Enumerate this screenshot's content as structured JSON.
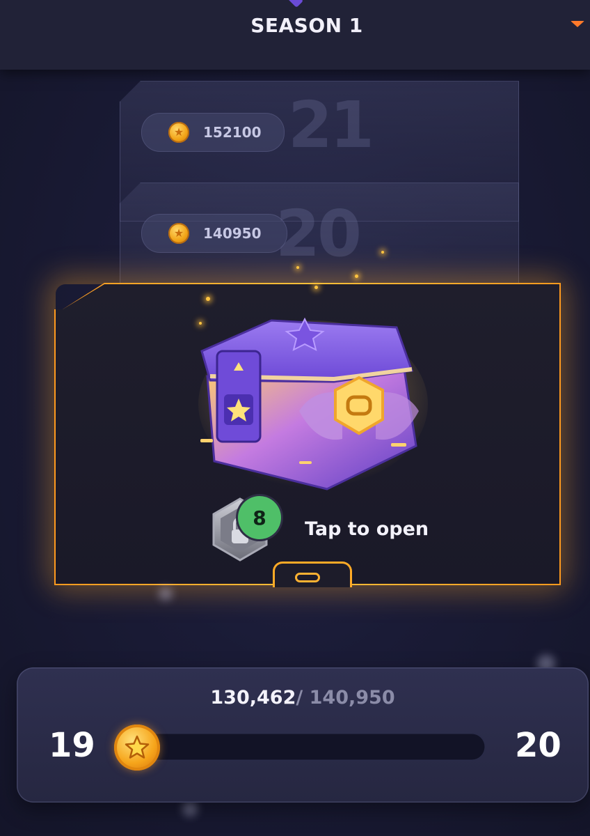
{
  "header": {
    "title": "SEASON 1"
  },
  "levels": [
    {
      "level": "21",
      "reward": "152100"
    },
    {
      "level": "20",
      "reward": "140950"
    }
  ],
  "chest": {
    "lock_count": "8",
    "action_label": "Tap to open"
  },
  "progress": {
    "current": "130,462",
    "separator": "/ ",
    "target": "140,950",
    "level_from": "19",
    "level_to": "20",
    "fraction": 0.0
  },
  "colors": {
    "accent": "#ff9a1e",
    "coin": "#f6a51b",
    "badge": "#4fbf68"
  }
}
